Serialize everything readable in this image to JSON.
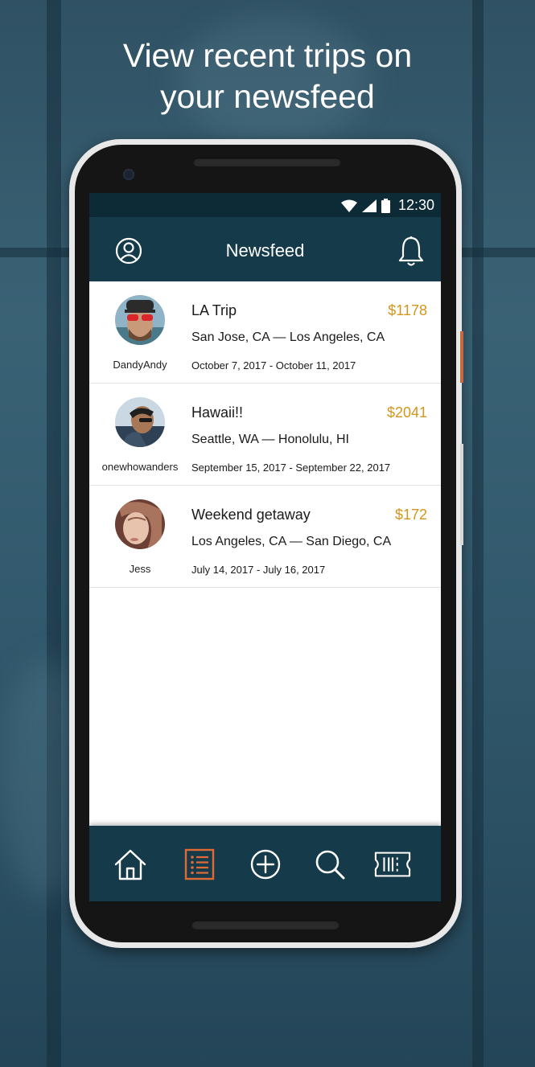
{
  "headline": {
    "line1": "View recent trips on",
    "line2": "your newsfeed"
  },
  "status_bar": {
    "time": "12:30",
    "icons": [
      "wifi-icon",
      "signal-icon",
      "battery-icon"
    ]
  },
  "app_bar": {
    "title": "Newsfeed",
    "left_icon": "profile-icon",
    "right_icon": "bell-icon"
  },
  "feed": [
    {
      "username": "DandyAndy",
      "title": "LA Trip",
      "price": "$1178",
      "route": "San Jose, CA — Los Angeles, CA",
      "dates": "October 7, 2017 - October 11, 2017"
    },
    {
      "username": "onewhowanders",
      "title": "Hawaii!!",
      "price": "$2041",
      "route": "Seattle, WA — Honolulu, HI",
      "dates": "September 15, 2017 - September 22, 2017"
    },
    {
      "username": "Jess",
      "title": "Weekend getaway",
      "price": "$172",
      "route": "Los Angeles, CA — San Diego, CA",
      "dates": "July 14, 2017 - July 16, 2017"
    }
  ],
  "bottom_nav": {
    "items": [
      "home-icon",
      "newsfeed-list-icon",
      "add-icon",
      "search-icon",
      "ticket-icon"
    ],
    "active": "newsfeed-list-icon"
  },
  "colors": {
    "accent": "#e06a36",
    "price": "#d2961c",
    "app_bar": "#153a4a",
    "status_bar": "#0d2a37"
  }
}
